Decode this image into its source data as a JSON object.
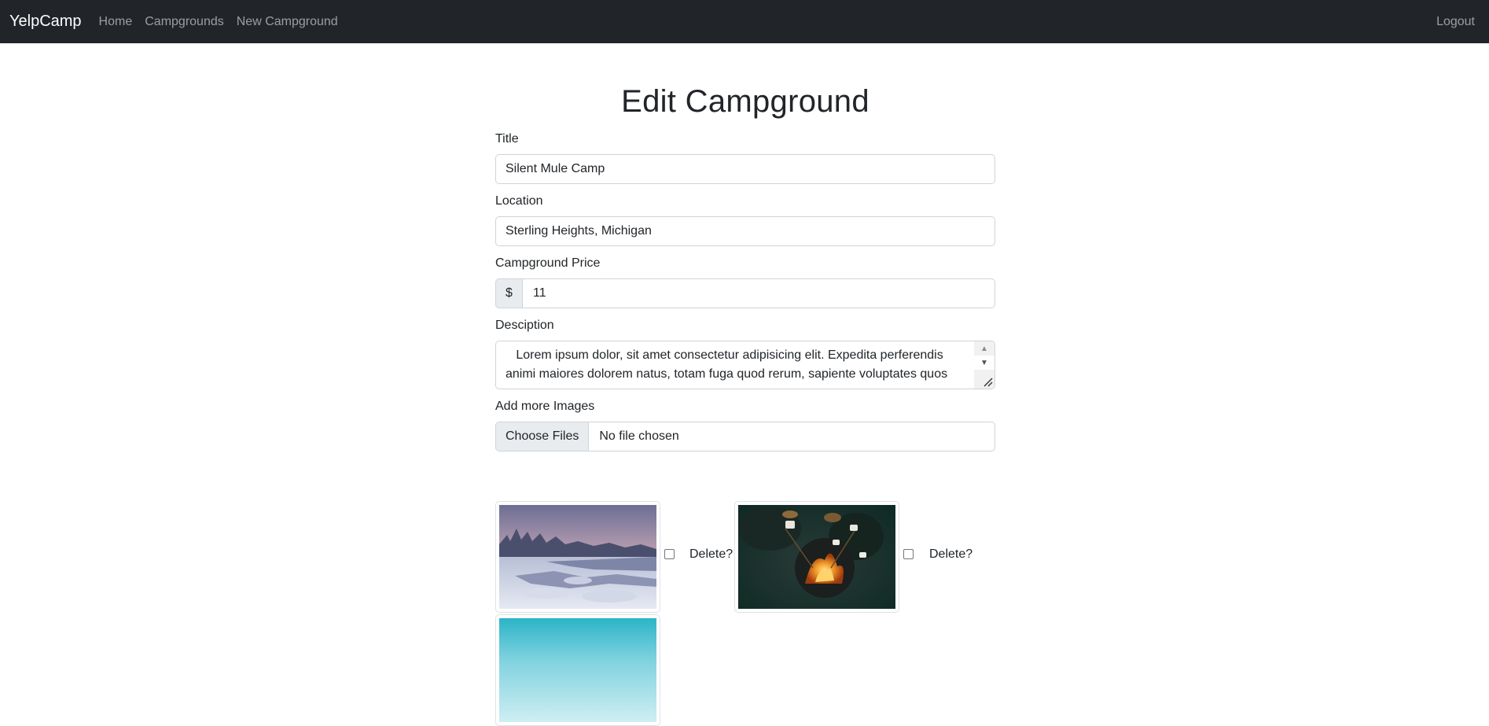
{
  "nav": {
    "brand": "YelpCamp",
    "links": [
      "Home",
      "Campgrounds",
      "New Campground"
    ],
    "logout": "Logout"
  },
  "page": {
    "title": "Edit Campground"
  },
  "form": {
    "title_label": "Title",
    "title_value": "Silent Mule Camp",
    "location_label": "Location",
    "location_value": "Sterling Heights, Michigan",
    "price_label": "Campground Price",
    "price_symbol": "$",
    "price_value": "11",
    "description_label": "Desciption",
    "description_value": "   Lorem ipsum dolor, sit amet consectetur adipisicing elit. Expedita perferendis animi maiores dolorem natus, totam fuga quod rerum, sapiente voluptates quos",
    "images_label": "Add more Images",
    "file_button": "Choose Files",
    "file_status": "No file chosen"
  },
  "images": [
    {
      "delete_label": "Delete?",
      "checked": false
    },
    {
      "delete_label": "Delete?",
      "checked": false
    },
    {
      "delete_label": "",
      "checked": false
    }
  ],
  "colors": {
    "navbar": "#212529",
    "text": "#212529",
    "border": "#ced4da",
    "addon": "#e9ecef"
  }
}
